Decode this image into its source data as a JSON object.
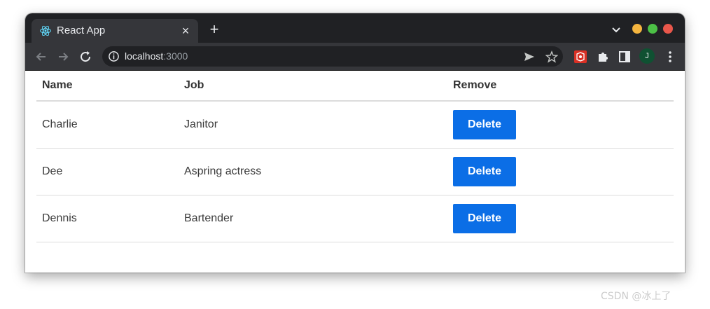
{
  "browser": {
    "tab_title": "React App",
    "url_host": "localhost",
    "url_port": ":3000",
    "avatar_letter": "J"
  },
  "table": {
    "headers": {
      "name": "Name",
      "job": "Job",
      "remove": "Remove"
    },
    "rows": [
      {
        "name": "Charlie",
        "job": "Janitor",
        "action": "Delete"
      },
      {
        "name": "Dee",
        "job": "Aspring actress",
        "action": "Delete"
      },
      {
        "name": "Dennis",
        "job": "Bartender",
        "action": "Delete"
      }
    ]
  },
  "colors": {
    "delete_button": "#0b6ee6",
    "tab_bar": "#202124",
    "toolbar": "#35363a"
  },
  "watermark": "CSDN @冰上了"
}
